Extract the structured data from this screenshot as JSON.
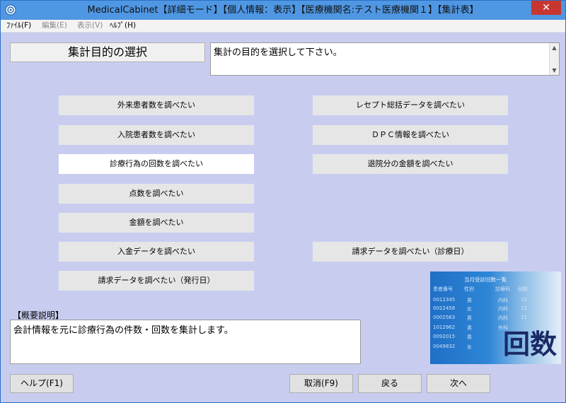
{
  "window": {
    "title": "MedicalCabinet【詳細モード】【個人情報：表示】【医療機関名:テスト医療機関１】【集計表】",
    "close_label": "✕"
  },
  "menu": {
    "file": "ﾌｧｲﾙ(F)",
    "edit": "編集(E)",
    "view": "表示(V)",
    "help": "ﾍﾙﾌﾟ(H)"
  },
  "purpose": {
    "label": "集計目的の選択",
    "instruction": "集計の目的を選択して下さい。"
  },
  "options": {
    "left": [
      "外来患者数を調べたい",
      "入院患者数を調べたい",
      "診療行為の回数を調べたい",
      "点数を調べたい",
      "金額を調べたい",
      "入金データを調べたい",
      "請求データを調べたい（発行日）"
    ],
    "right": [
      "レセプト総括データを調べたい",
      "ＤＰＣ情報を調べたい",
      "退院分の金額を調べたい",
      "請求データを調べたい（診療日）"
    ]
  },
  "summary": {
    "label": "【概要説明】",
    "text": "会計情報を元に診療行為の件数・回数を集計します。"
  },
  "illustration": {
    "header": "当月受診回数一覧",
    "columns": [
      "患者番号",
      "性別",
      "診療科",
      "回数"
    ],
    "rows": [
      [
        "0012345",
        "男",
        "内科",
        "15"
      ],
      [
        "0022458",
        "女",
        "内科",
        "12"
      ],
      [
        "0002563",
        "男",
        "内科",
        "11"
      ],
      [
        "1012962",
        "男",
        "外科",
        ""
      ],
      [
        "0092015",
        "男",
        "",
        ""
      ],
      [
        "0049832",
        "女",
        "",
        ""
      ]
    ],
    "big_text": "回数"
  },
  "footer": {
    "help": "ヘルプ(F1)",
    "cancel": "取消(F9)",
    "back": "戻る",
    "next": "次へ"
  },
  "colors": {
    "background": "#c8cdf0",
    "titlebar": "#4f97e3",
    "button": "#e6e6e6",
    "selected_button": "#ffffff"
  }
}
